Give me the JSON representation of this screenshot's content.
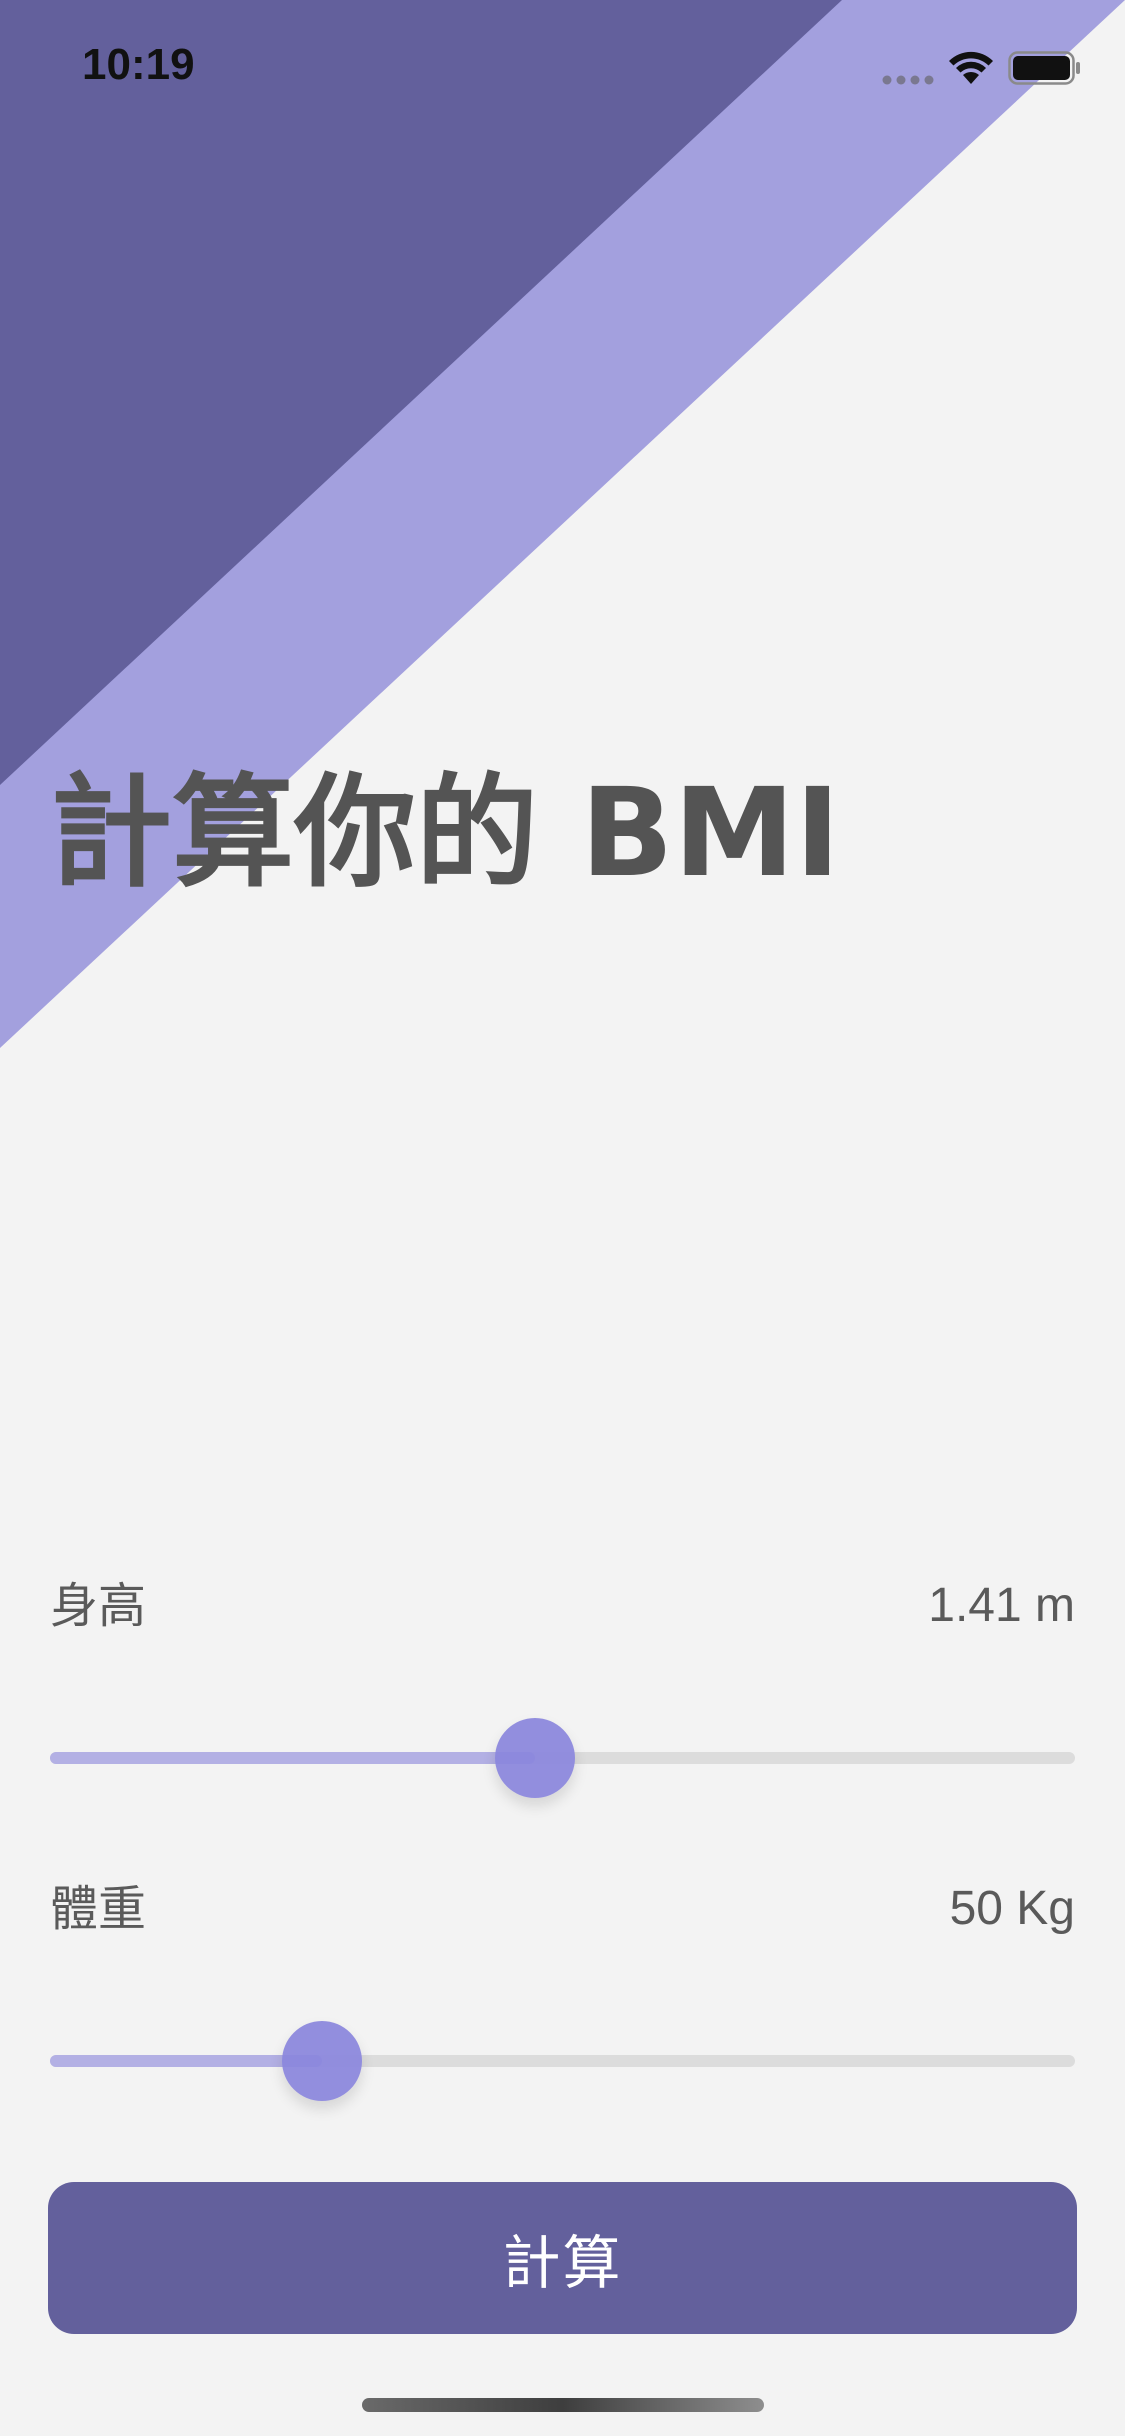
{
  "colors": {
    "background": "#f3f3f3",
    "dark_purple": "#63609c",
    "light_purple": "#a3a0de",
    "thumb": "#8a86dc",
    "track_fill": "#b3b0e4",
    "track": "#dcdcdc",
    "text": "#545454"
  },
  "status_bar": {
    "time": "10:19"
  },
  "title": "計算你的 BMI",
  "height": {
    "label": "身高",
    "value": "1.41 m",
    "slider_fraction": 0.473
  },
  "weight": {
    "label": "體重",
    "value": "50 Kg",
    "slider_fraction": 0.265
  },
  "button": {
    "label": "計算"
  }
}
